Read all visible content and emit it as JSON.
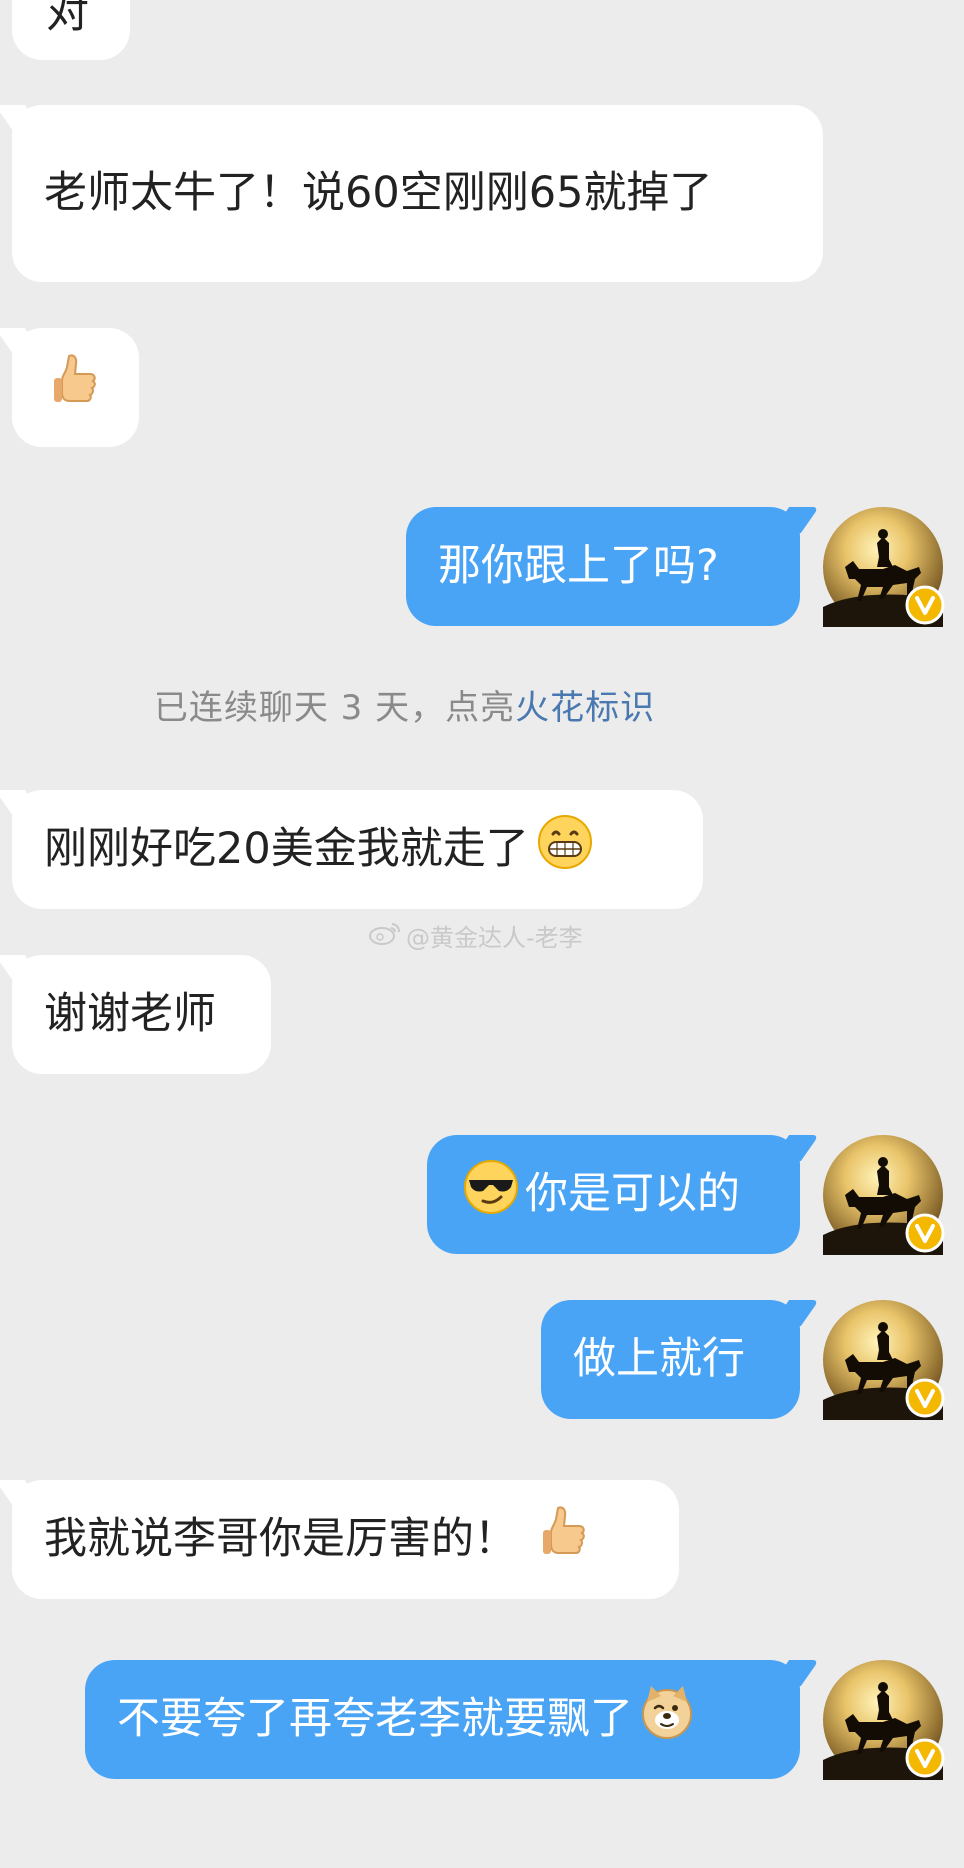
{
  "messages": [
    {
      "side": "in",
      "text": "对",
      "emoji": null
    },
    {
      "side": "in",
      "text": "老师太牛了！说60空刚刚65就掉了",
      "emoji": null
    },
    {
      "side": "in",
      "text": "",
      "emoji": "thumbs-up"
    },
    {
      "side": "out",
      "text": "那你跟上了吗?",
      "emoji": null
    },
    {
      "side": "in",
      "text": "刚刚好吃20美金我就走了",
      "emoji": "grinning-face"
    },
    {
      "side": "in",
      "text": "谢谢老师",
      "emoji": null
    },
    {
      "side": "out",
      "text": "你是可以的",
      "emoji": "sunglasses-face"
    },
    {
      "side": "out",
      "text": "做上就行",
      "emoji": null
    },
    {
      "side": "in",
      "text": "我就说李哥你是厉害的！",
      "emoji": "thumbs-up"
    },
    {
      "side": "out",
      "text": "不要夸了再夸老李就要飘了",
      "emoji": "doge-face"
    }
  ],
  "notice": {
    "prefix": "已连续聊天 3 天，点亮",
    "link": "火花标识"
  },
  "watermark": "@黄金达人-老李",
  "avatar": {
    "badge_label": "V"
  },
  "colors": {
    "background": "#ececec",
    "incoming_bubble": "#ffffff",
    "outgoing_bubble": "#4aa4f6",
    "link": "#4a78b0",
    "badge": "#f5b800"
  }
}
